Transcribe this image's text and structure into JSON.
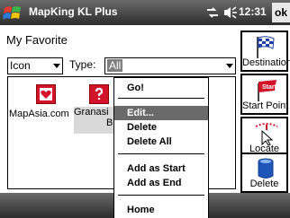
{
  "titlebar": {
    "app_title": "MapKing KL Plus",
    "clock": "12:31",
    "ok": "ok"
  },
  "page": {
    "heading": "My Favorite"
  },
  "filters": {
    "icon_value": "Icon",
    "type_label": "Type:",
    "type_value": "All"
  },
  "favorites": [
    {
      "label": "MapAsia.com",
      "icon": "heart-icon"
    },
    {
      "label_line1": "Granasi",
      "label_line2": "Bh",
      "icon": "question-icon"
    }
  ],
  "toolbar": {
    "destination": "Destination",
    "start_point": "Start Point",
    "start_sign_text": "Start",
    "locate": "Locate",
    "delete": "Delete"
  },
  "context_menu": {
    "items": [
      "Go!",
      "Edit...",
      "Delete",
      "Delete All",
      "Add as Start",
      "Add as End",
      "Home"
    ],
    "highlighted": "Edit..."
  },
  "colors": {
    "highlight": "#6a6a6a",
    "selection": "#7f7f7f",
    "bar": "#2c2c2c"
  }
}
